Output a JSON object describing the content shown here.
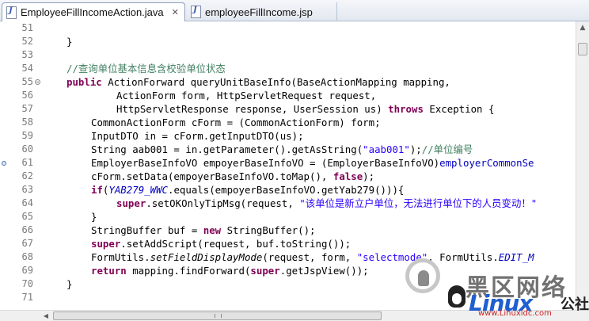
{
  "tabs": [
    {
      "label": "EmployeeFillIncomeAction.java",
      "active": true,
      "icon": "java-file-icon"
    },
    {
      "label": "employeeFillIncome.jsp",
      "active": false,
      "icon": "jsp-file-icon"
    }
  ],
  "tab_close_glyph": "✕",
  "editor": {
    "line_numbers": [
      "51",
      "52",
      "53",
      "54",
      "55",
      "56",
      "57",
      "58",
      "59",
      "60",
      "61",
      "62",
      "63",
      "64",
      "65",
      "66",
      "67",
      "68",
      "69",
      "70",
      "71"
    ]
  },
  "code": {
    "l52": "}",
    "l54": "//查询单位基本信息含校验单位状态",
    "l55_kw": "public",
    "l55_rest": " ActionForward queryUnitBaseInfo(BaseActionMapping mapping,",
    "l56": "ActionForm form, HttpServletRequest request,",
    "l57_a": "HttpServletResponse response, UserSession us) ",
    "l57_kw": "throws",
    "l57_b": " Exception {",
    "l58": "CommonActionForm cForm = (CommonActionForm) form;",
    "l59": "InputDTO in = cForm.getInputDTO(us);",
    "l60_a": "String aab001 = in.getParameter().getAsString(",
    "l60_str": "\"aab001\"",
    "l60_b": ");",
    "l60_cm": "//单位编号",
    "l61_a": "EmployerBaseInfoVO empoyerBaseInfoVO = (EmployerBaseInfoVO)",
    "l61_fld": "employerCommonSe",
    "l62_a": "cForm.setData(empoyerBaseInfoVO.toMap(), ",
    "l62_kw": "false",
    "l62_b": ");",
    "l63_kw": "if",
    "l63_b": "(",
    "l63_const": "YAB279_WWC",
    "l63_c": ".equals(empoyerBaseInfoVO.getYab279())){",
    "l64_kw": "super",
    "l64_b": ".setOKOnlyTipMsg(request, ",
    "l64_str": "\"该单位是新立户单位，无法进行单位下的人员变动！\"",
    "l65": "}",
    "l66_a": "StringBuffer buf = ",
    "l66_kw": "new",
    "l66_b": " StringBuffer();",
    "l67_kw": "super",
    "l67_b": ".setAddScript(request, buf.toString());",
    "l68_a": "FormUtils.",
    "l68_mi": "setFieldDisplayMode",
    "l68_b": "(request, form, ",
    "l68_str": "\"selectmode\"",
    "l68_c": ", FormUtils.",
    "l68_const": "EDIT_M",
    "l69_kw1": "return",
    "l69_b": " mapping.findForward(",
    "l69_kw2": "super",
    "l69_c": ".getJspView());",
    "l70": "}"
  },
  "scroll": {
    "up": "▲",
    "left": "◀"
  },
  "watermark": {
    "cn_text": "黑区网络",
    "brand": "Linux",
    "brand_suffix": "公社",
    "url": "www.Linuxidc.com"
  },
  "colors": {
    "keyword": "#7f0055",
    "comment": "#3f7f5f",
    "string": "#2a00ff",
    "field": "#0000c0"
  }
}
